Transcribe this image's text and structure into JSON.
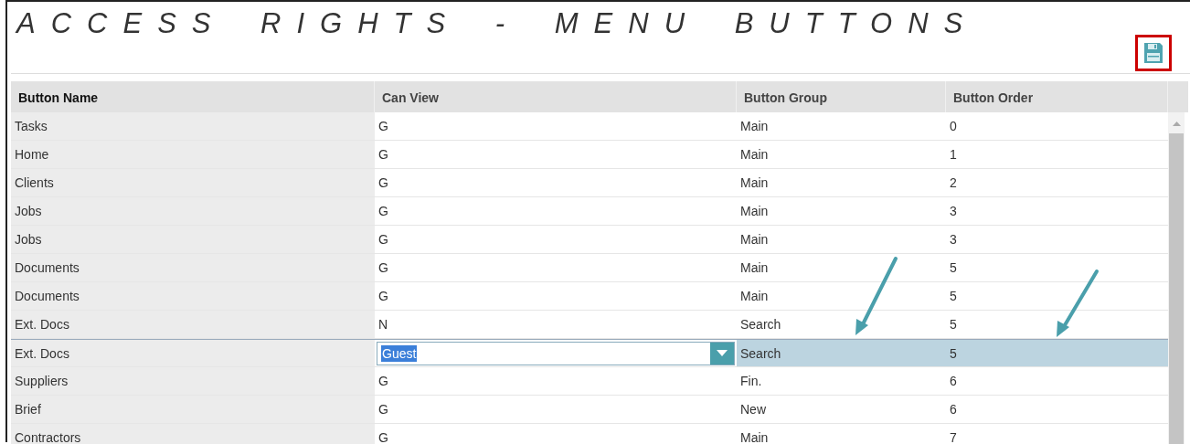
{
  "title": "ACCESS RIGHTS - MENU BUTTONS",
  "table": {
    "columns": [
      "Button Name",
      "Can View",
      "Button Group",
      "Button Order"
    ],
    "rows": [
      {
        "name": "Tasks",
        "can_view": "G",
        "group": "Main",
        "order": "0",
        "selected": false
      },
      {
        "name": "Home",
        "can_view": "G",
        "group": "Main",
        "order": "1",
        "selected": false
      },
      {
        "name": "Clients",
        "can_view": "G",
        "group": "Main",
        "order": "2",
        "selected": false
      },
      {
        "name": "Jobs",
        "can_view": "G",
        "group": "Main",
        "order": "3",
        "selected": false
      },
      {
        "name": "Jobs",
        "can_view": "G",
        "group": "Main",
        "order": "3",
        "selected": false
      },
      {
        "name": "Documents",
        "can_view": "G",
        "group": "Main",
        "order": "5",
        "selected": false
      },
      {
        "name": "Documents",
        "can_view": "G",
        "group": "Main",
        "order": "5",
        "selected": false
      },
      {
        "name": "Ext. Docs",
        "can_view": "N",
        "group": "Search",
        "order": "5",
        "selected": false
      },
      {
        "name": "Ext. Docs",
        "can_view": "Guest",
        "group": "Search",
        "order": "5",
        "selected": true
      },
      {
        "name": "Suppliers",
        "can_view": "G",
        "group": "Fin.",
        "order": "6",
        "selected": false
      },
      {
        "name": "Brief",
        "can_view": "G",
        "group": "New",
        "order": "6",
        "selected": false
      },
      {
        "name": "Contractors",
        "can_view": "G",
        "group": "Main",
        "order": "7",
        "selected": false
      }
    ]
  }
}
